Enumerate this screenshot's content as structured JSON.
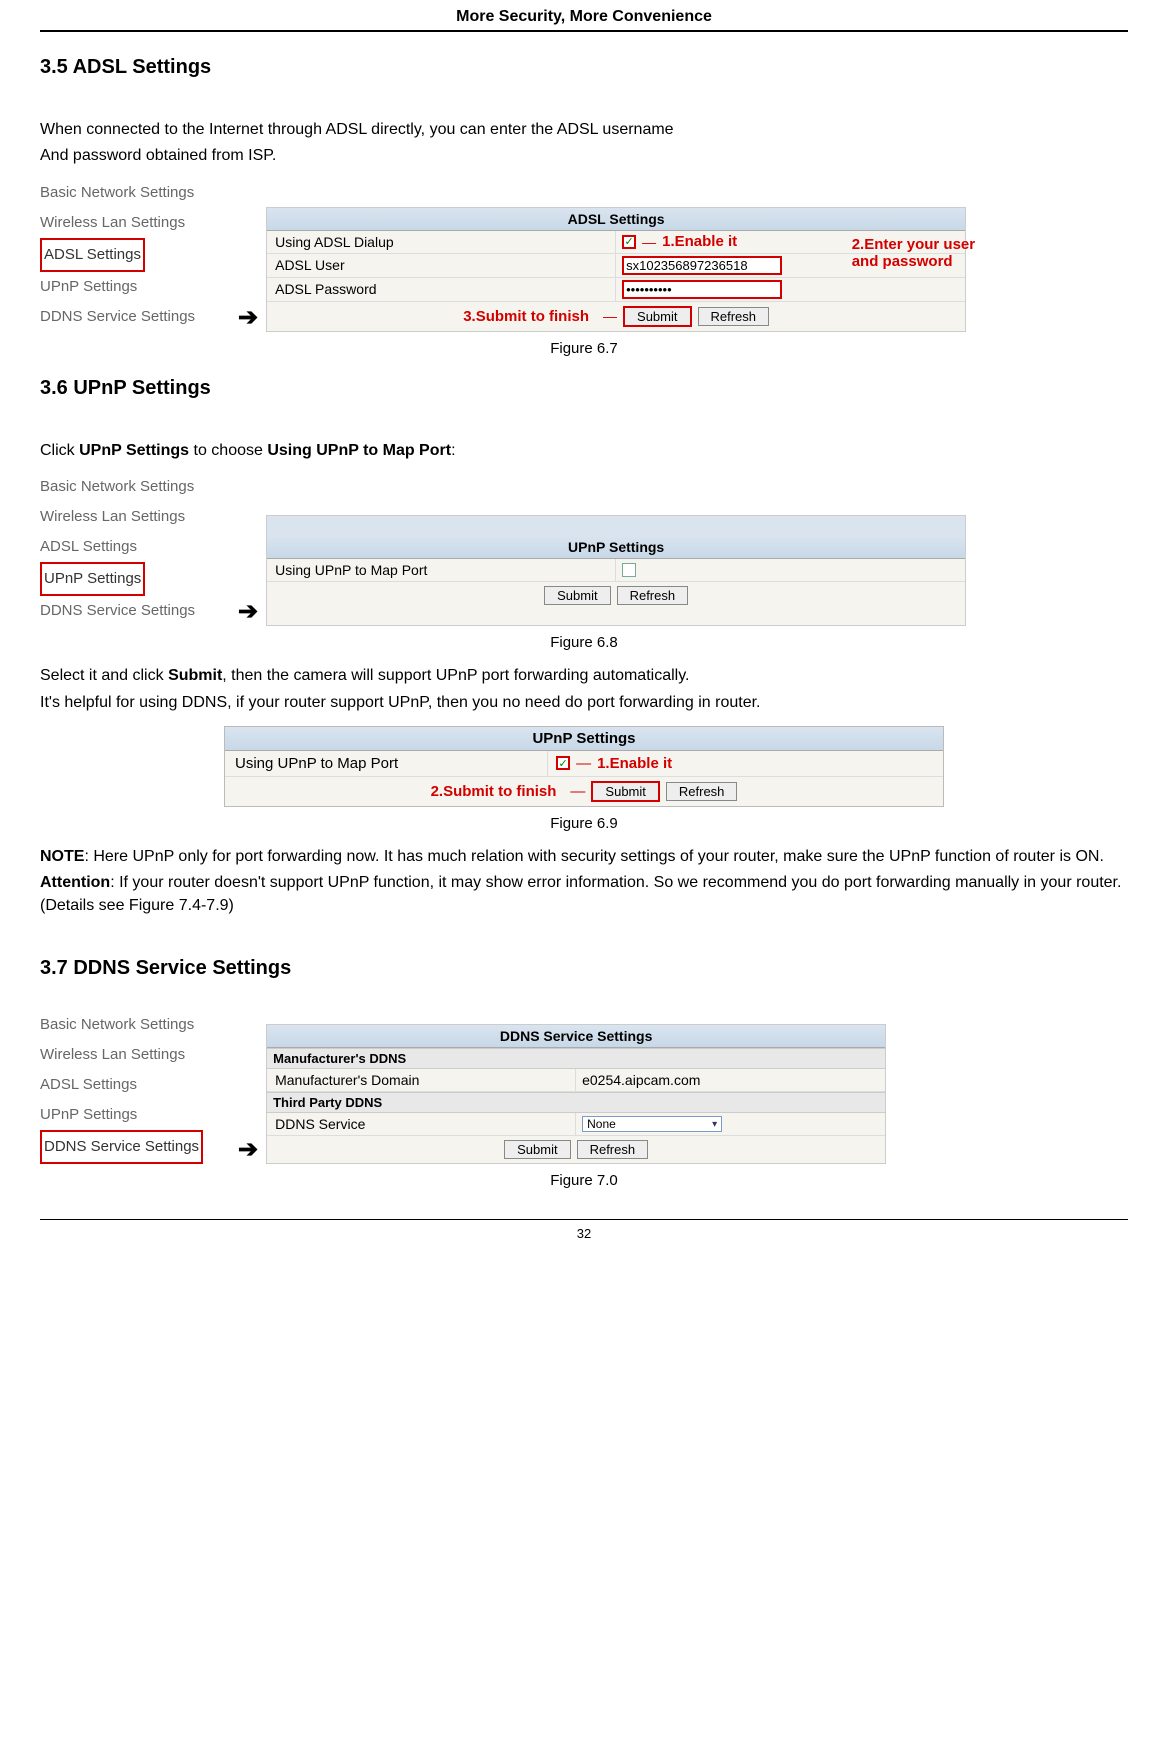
{
  "header": "More Security, More Convenience",
  "page_number": "32",
  "section_3_5": {
    "heading": "3.5 ADSL Settings",
    "intro1": "When connected to the Internet through ADSL directly, you can enter the ADSL username",
    "intro2": "And password obtained from ISP."
  },
  "fig_6_7": {
    "nav": {
      "basic": "Basic Network Settings",
      "wireless": "Wireless Lan Settings",
      "adsl": "ADSL Settings",
      "upnp": "UPnP Settings",
      "ddns": "DDNS Service Settings"
    },
    "panel": {
      "title": "ADSL Settings",
      "row1_label": "Using ADSL Dialup",
      "row2_label": "ADSL User",
      "row2_value": "sx102356897236518",
      "row3_label": "ADSL Password",
      "row3_value": "••••••••••",
      "ann1": "1.Enable it",
      "ann2a": "2.Enter your user",
      "ann2b": "and password",
      "ann3": "3.Submit to finish",
      "submit": "Submit",
      "refresh": "Refresh"
    },
    "caption": "Figure 6.7"
  },
  "section_3_6": {
    "heading": "3.6 UPnP Settings",
    "intro_pre": "Click ",
    "intro_b1": "UPnP Settings",
    "intro_mid": " to choose ",
    "intro_b2": "Using UPnP to Map Port",
    "intro_post": ":"
  },
  "fig_6_8": {
    "nav": {
      "basic": "Basic Network Settings",
      "wireless": "Wireless Lan Settings",
      "adsl": "ADSL Settings",
      "upnp": "UPnP Settings",
      "ddns": "DDNS Service Settings"
    },
    "panel": {
      "title": "UPnP Settings",
      "row1_label": "Using UPnP to Map Port",
      "submit": "Submit",
      "refresh": "Refresh"
    },
    "caption": "Figure 6.8"
  },
  "post_6_8": {
    "line1_pre": "Select it and click ",
    "line1_b": "Submit",
    "line1_post": ", then the camera will support UPnP port forwarding automatically.",
    "line2": "It's helpful for using DDNS, if your router support UPnP, then you no need do port forwarding in router."
  },
  "fig_6_9": {
    "panel": {
      "title": "UPnP Settings",
      "row1_label": "Using UPnP to Map Port",
      "ann1": "1.Enable it",
      "ann2": "2.Submit to finish",
      "submit": "Submit",
      "refresh": "Refresh"
    },
    "caption": "Figure 6.9"
  },
  "post_6_9": {
    "note_b": "NOTE",
    "note_post": ": Here UPnP only for port forwarding now. It has much relation with security settings of your router, make sure the UPnP function of router is ON.",
    "att_b": "Attention",
    "att_post": ": If your router doesn't support UPnP function, it may show error information. So we recommend you do port forwarding manually in your router. (Details see Figure 7.4-7.9)"
  },
  "section_3_7": {
    "heading": "3.7 DDNS Service Settings"
  },
  "fig_7_0": {
    "nav": {
      "basic": "Basic Network Settings",
      "wireless": "Wireless Lan Settings",
      "adsl": "ADSL Settings",
      "upnp": "UPnP Settings",
      "ddns": "DDNS Service Settings"
    },
    "panel": {
      "title": "DDNS Service Settings",
      "sub1": "Manufacturer's DDNS",
      "row1_label": "Manufacturer's Domain",
      "row1_value": "e0254.aipcam.com",
      "sub2": "Third Party DDNS",
      "row2_label": "DDNS Service",
      "row2_value": "None",
      "submit": "Submit",
      "refresh": "Refresh"
    },
    "caption": "Figure 7.0"
  },
  "glyphs": {
    "arrow": "➔",
    "check": "✓"
  }
}
